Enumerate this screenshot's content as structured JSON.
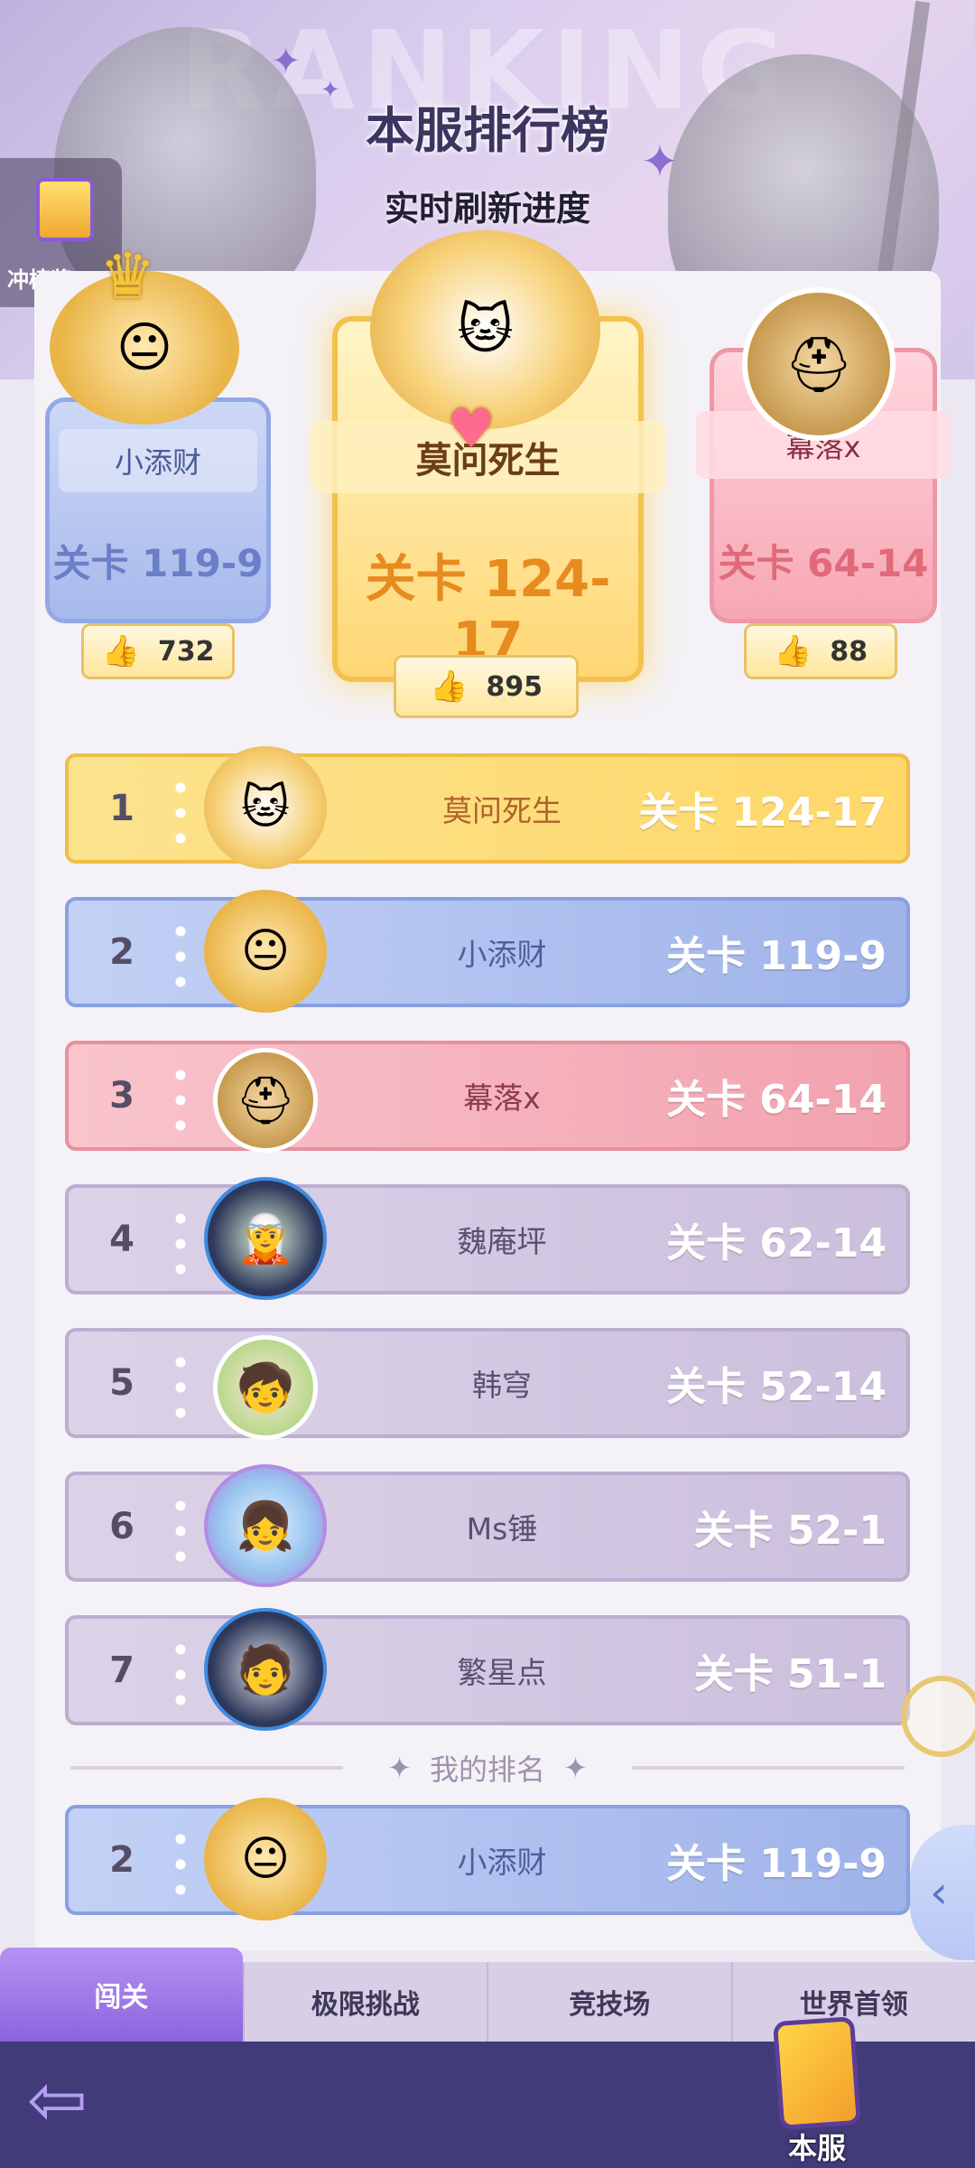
{
  "header": {
    "watermark": "RANKING",
    "title": "本服排行榜",
    "subtitle": "实时刷新进度",
    "reward_label": "冲榜奖"
  },
  "podium": {
    "first": {
      "name": "莫问死生",
      "stage": "关卡 124-17",
      "likes": "895"
    },
    "second": {
      "name": "小添财",
      "stage": "关卡 119-9",
      "likes": "732"
    },
    "third": {
      "name": "幕落x",
      "stage": "关卡 64-14",
      "likes": "88"
    }
  },
  "rankings": [
    {
      "rank": "1",
      "name": "莫问死生",
      "stage": "关卡 124-17"
    },
    {
      "rank": "2",
      "name": "小添财",
      "stage": "关卡 119-9"
    },
    {
      "rank": "3",
      "name": "幕落x",
      "stage": "关卡 64-14"
    },
    {
      "rank": "4",
      "name": "魏庵坪",
      "stage": "关卡 62-14"
    },
    {
      "rank": "5",
      "name": "韩穹",
      "stage": "关卡 52-14"
    },
    {
      "rank": "6",
      "name": "Ms锤",
      "stage": "关卡 52-1"
    },
    {
      "rank": "7",
      "name": "繁星点",
      "stage": "关卡 51-1"
    }
  ],
  "my_rank": {
    "label": "我的排名",
    "rank": "2",
    "name": "小添财",
    "stage": "关卡 119-9"
  },
  "tabs": [
    {
      "label": "闯关",
      "active": true
    },
    {
      "label": "极限挑战",
      "active": false
    },
    {
      "label": "竞技场",
      "active": false
    },
    {
      "label": "世界首领",
      "active": false
    }
  ],
  "bottom": {
    "server_label": "本服"
  },
  "icons": {
    "like": "thumbs-up-icon",
    "back": "back-arrow-icon",
    "side": "chevron-left-icon"
  }
}
